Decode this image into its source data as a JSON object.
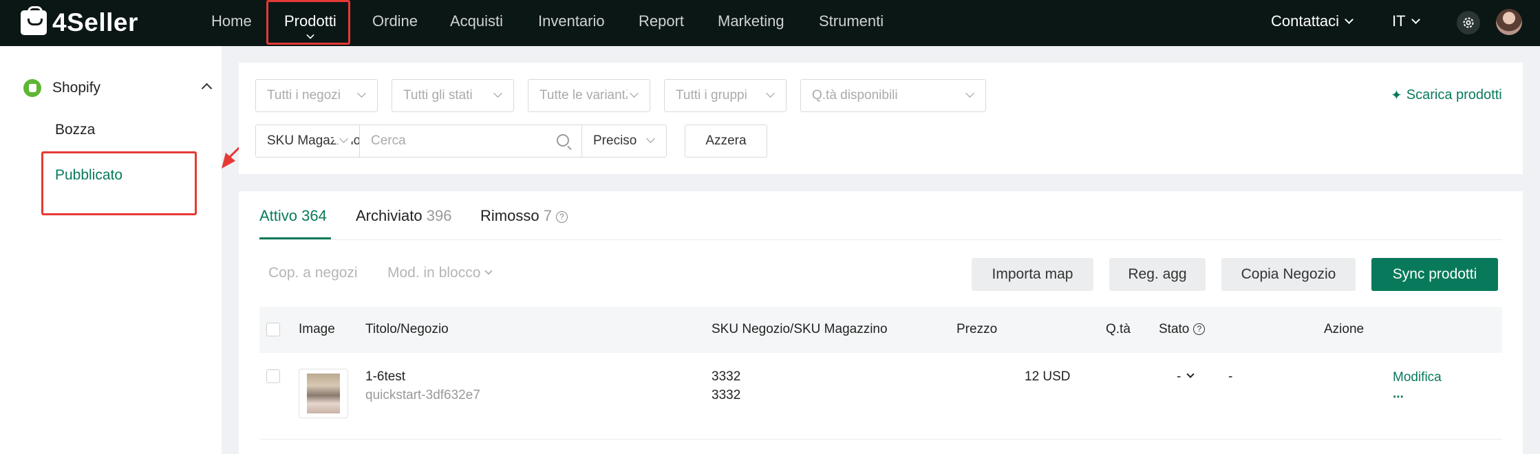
{
  "brand": {
    "name": "4Seller"
  },
  "nav": {
    "items": [
      "Home",
      "Prodotti",
      "Ordine",
      "Acquisti",
      "Inventario",
      "Report",
      "Marketing",
      "Strumenti"
    ],
    "active": "Prodotti",
    "contact": "Contattaci",
    "language": "IT"
  },
  "sidebar": {
    "store": "Shopify",
    "items": [
      "Bozza",
      "Pubblicato"
    ],
    "active": "Pubblicato"
  },
  "filters": {
    "stores": "Tutti i negozi",
    "states": "Tutti gli stati",
    "variants": "Tutte le varianti",
    "groups": "Tutti i gruppi",
    "qty": "Q.tà disponibili",
    "sku_type": "SKU Magazzino",
    "search_placeholder": "Cerca",
    "match": "Preciso",
    "reset": "Azzera",
    "download": "Scarica prodotti"
  },
  "tabs": [
    {
      "label": "Attivo",
      "count": "364"
    },
    {
      "label": "Archiviato",
      "count": "396"
    },
    {
      "label": "Rimosso",
      "count": "7"
    }
  ],
  "actions": {
    "copy": "Cop. a negozi",
    "bulk": "Mod. in blocco",
    "import_map": "Importa map",
    "reg": "Reg. agg",
    "copy_store": "Copia Negozio",
    "sync": "Sync prodotti"
  },
  "table": {
    "headers": [
      "Image",
      "Titolo/Negozio",
      "SKU Negozio/SKU Magazzino",
      "Prezzo",
      "Q.tà",
      "Stato",
      "Azione"
    ],
    "rows": [
      {
        "title": "1-6test",
        "store": "quickstart-3df632e7",
        "sku_store": "3332",
        "sku_warehouse": "3332",
        "price": "12 USD",
        "qty": "-",
        "status": "-",
        "action": "Modifica",
        "more": "..."
      }
    ]
  },
  "colors": {
    "accent": "#087a5b",
    "topbar": "#0b1715",
    "highlight": "#e53935"
  }
}
